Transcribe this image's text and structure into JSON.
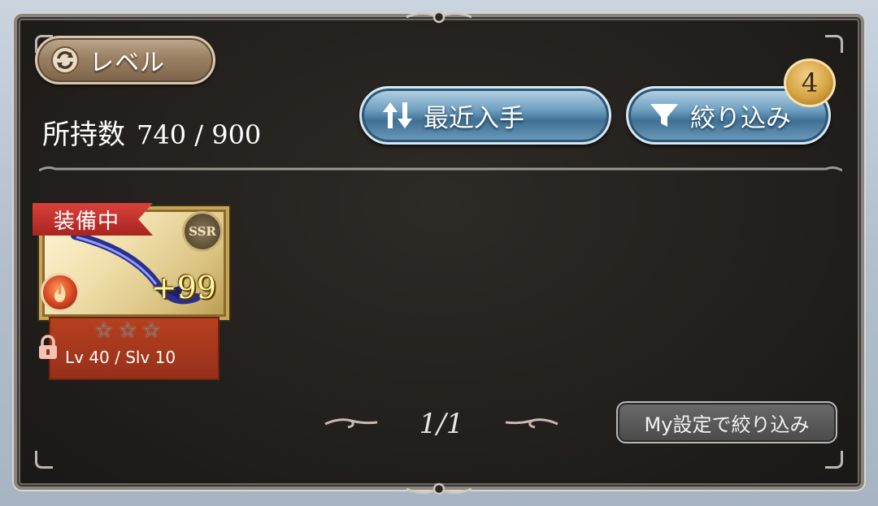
{
  "sort_mode": {
    "label": "レベル",
    "icon": "cycle-icon"
  },
  "holdings": {
    "label": "所持数",
    "value": "740 / 900"
  },
  "buttons": {
    "recent": {
      "label": "最近入手",
      "icon": "sort-arrows-icon"
    },
    "filter": {
      "label": "絞り込み",
      "icon": "funnel-icon",
      "badge": "4"
    }
  },
  "items": [
    {
      "equipped_label": "装備中",
      "rarity": "SSR",
      "plus": "+99",
      "stars": "☆☆☆",
      "level_text": "Lv 40 / Slv 10",
      "element": "fire",
      "locked": true
    }
  ],
  "pager": {
    "text": "1/1"
  },
  "my_filter_button": {
    "label": "My設定で絞り込み"
  },
  "colors": {
    "panel_bg": "#221f1c",
    "accent_blue": "#6f9fc0",
    "ribbon_red": "#c2312c",
    "badge_gold": "#d6a443"
  }
}
